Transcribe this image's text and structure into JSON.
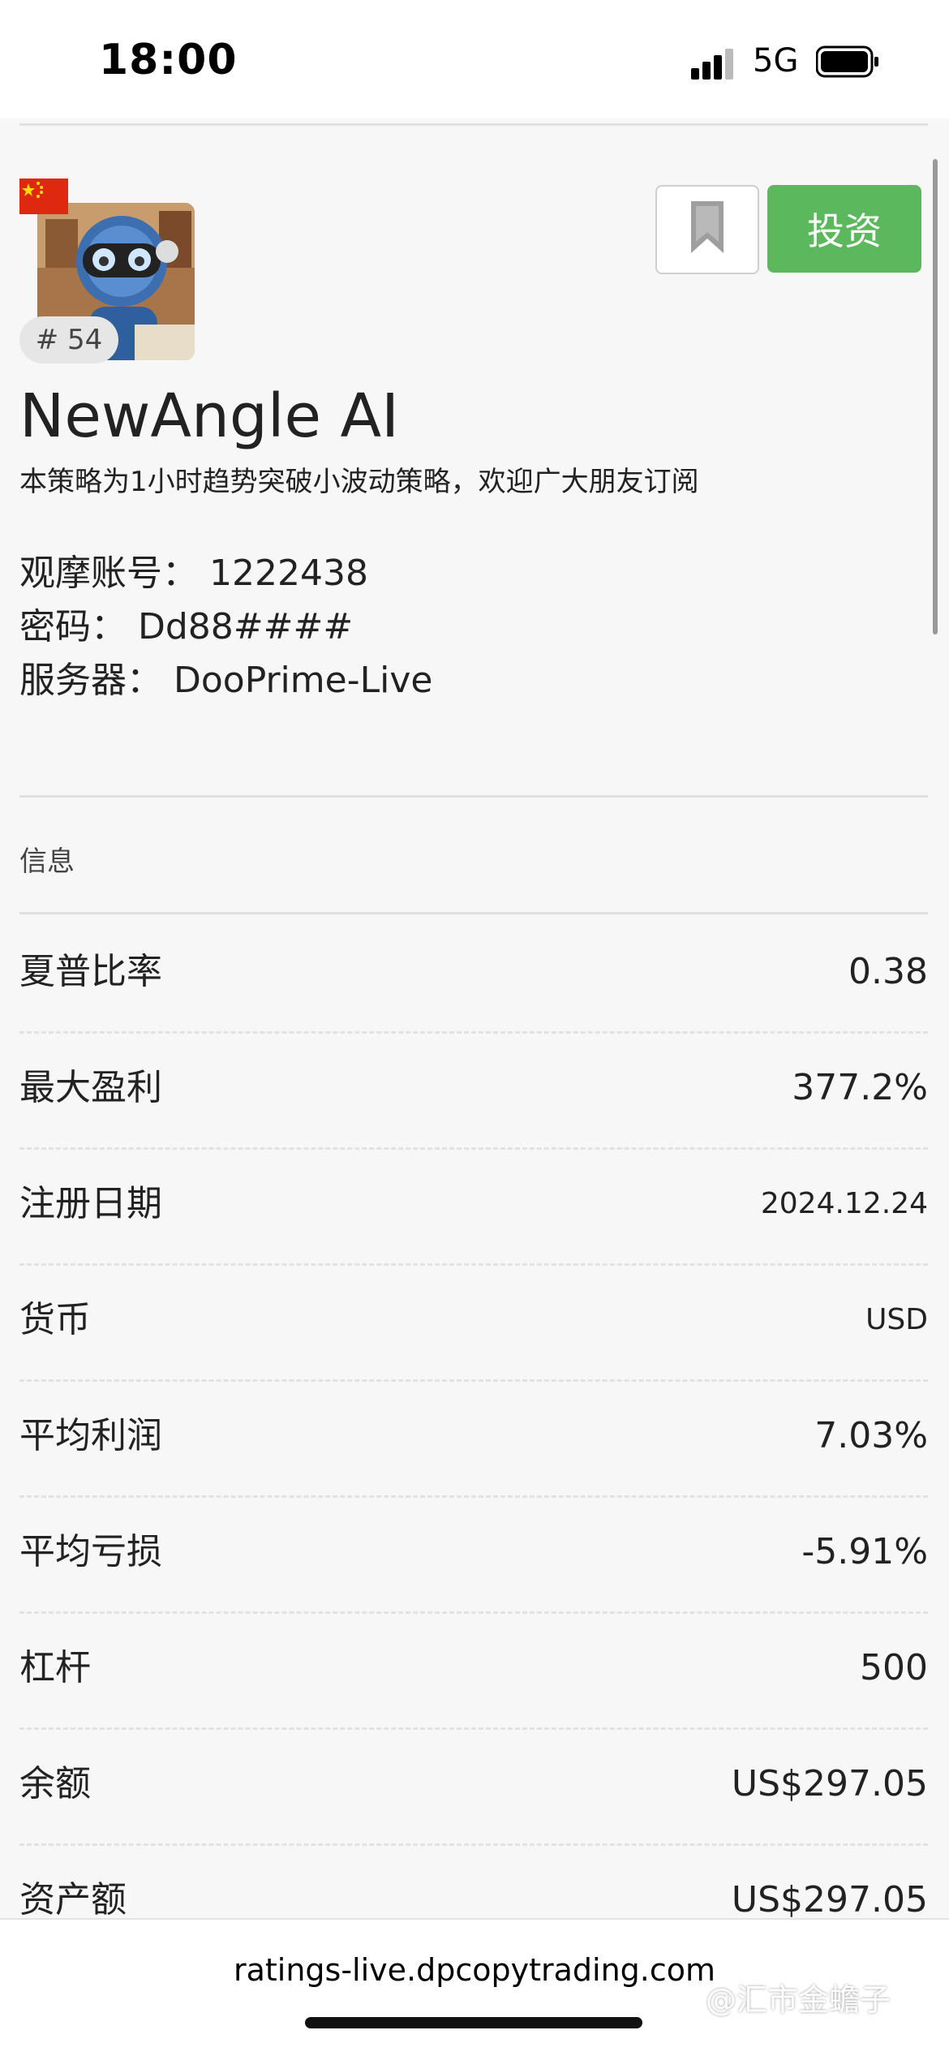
{
  "status_bar": {
    "time": "18:00",
    "network": "5G"
  },
  "strategy": {
    "rank": "# 54",
    "name": "NewAngle AI",
    "description": "本策略为1小时趋势突破小波动策略，欢迎广大朋友订阅",
    "credentials": [
      "观摩账号：  1222438",
      "密码：  Dd88####",
      "服务器：  DooPrime-Live"
    ],
    "invest_label": "投资"
  },
  "info": {
    "section_title": "信息",
    "rows": [
      {
        "label": "夏普比率",
        "value": "0.38"
      },
      {
        "label": "最大盈利",
        "value": "377.2%"
      },
      {
        "label": "注册日期",
        "value": "2024.12.24"
      },
      {
        "label": "货币",
        "value": "USD"
      },
      {
        "label": "平均利润",
        "value": "7.03%"
      },
      {
        "label": "平均亏损",
        "value": "-5.91%"
      },
      {
        "label": "杠杆",
        "value": "500"
      },
      {
        "label": "余额",
        "value": "US$297.05"
      },
      {
        "label": "资产额",
        "value": "US$297.05"
      }
    ]
  },
  "browser": {
    "url": "ratings-live.dpcopytrading.com",
    "watermark": "@汇市金蟾子"
  },
  "colors": {
    "accent": "#5cb85c",
    "background": "#f7f7f7"
  }
}
